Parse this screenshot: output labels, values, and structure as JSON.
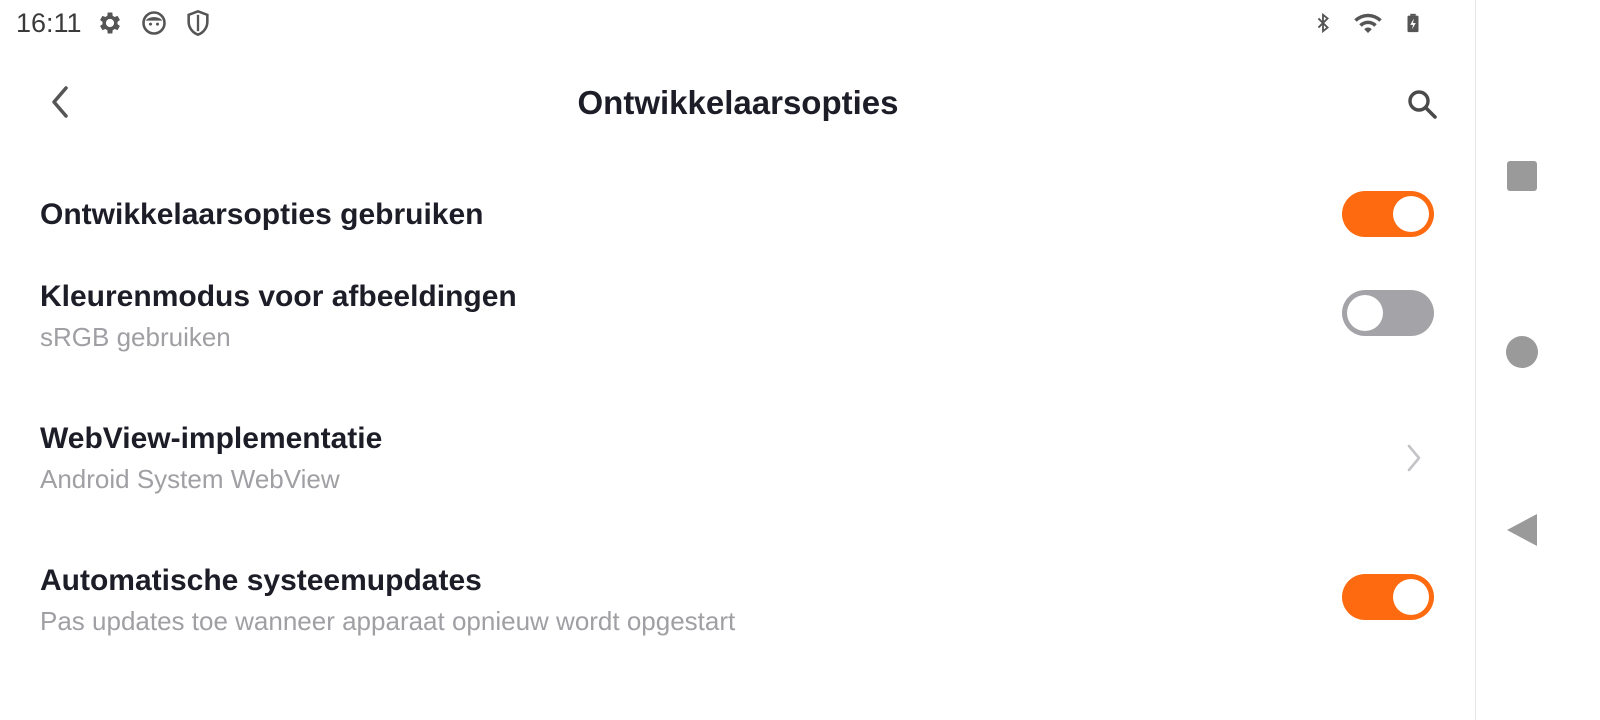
{
  "status_bar": {
    "time": "16:11",
    "left_icons": [
      "settings-gear-icon",
      "face-icon",
      "shield-icon"
    ],
    "right_icons": [
      "bluetooth-icon",
      "wifi-icon",
      "battery-charging-icon"
    ]
  },
  "app_bar": {
    "back_icon": "chevron-left-icon",
    "title": "Ontwikkelaarsopties",
    "search_icon": "search-icon"
  },
  "settings": [
    {
      "title": "Ontwikkelaarsopties gebruiken",
      "subtitle": "",
      "control": "toggle",
      "enabled": true
    },
    {
      "title": "Kleurenmodus voor afbeeldingen",
      "subtitle": "sRGB gebruiken",
      "control": "toggle",
      "enabled": false
    },
    {
      "title": "WebView-implementatie",
      "subtitle": "Android System WebView",
      "control": "chevron"
    },
    {
      "title": "Automatische systeemupdates",
      "subtitle": "Pas updates toe wanneer apparaat opnieuw wordt opgestart",
      "control": "toggle",
      "enabled": true
    }
  ],
  "nav_bar": {
    "buttons": [
      "recents-square-icon",
      "home-circle-icon",
      "back-triangle-icon"
    ]
  },
  "colors": {
    "accent": "#fd6a10",
    "toggle_off": "#a4a4a8",
    "title_text": "#1d1d28",
    "subtitle_text": "#a0a0a4",
    "nav_icon": "#9a9a9a"
  }
}
